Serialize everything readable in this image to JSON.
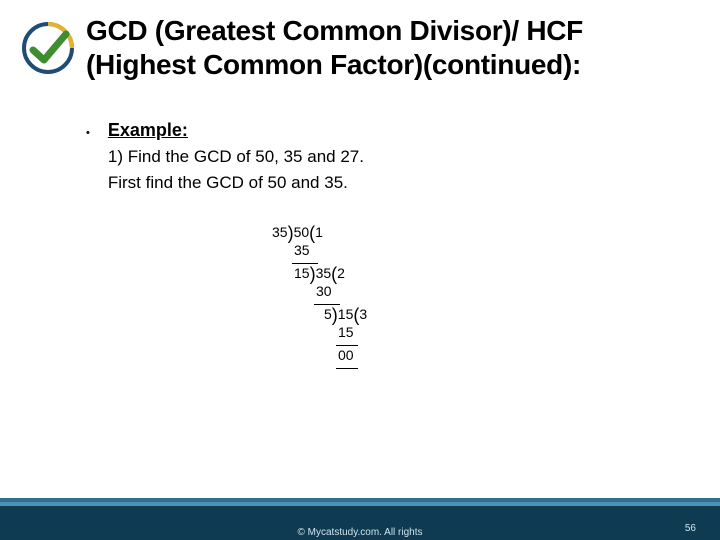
{
  "title": "GCD (Greatest Common Divisor)/ HCF (Highest Common Factor)(continued):",
  "bullet": {
    "example_label": "Example:",
    "line1": "1) Find the GCD of 50, 35 and 27.",
    "line2": "First find the GCD of 50 and 35."
  },
  "calculation": {
    "steps": [
      {
        "divisor": "35",
        "dividend": "50",
        "quotient": "1",
        "product": "35",
        "remainder": "15"
      },
      {
        "divisor": "15",
        "dividend": "35",
        "quotient": "2",
        "product": "30",
        "remainder": "5"
      },
      {
        "divisor": "5",
        "dividend": "15",
        "quotient": "3",
        "product": "15",
        "remainder": "00"
      }
    ]
  },
  "footer": {
    "copyright": "© Mycatstudy.com. All rights",
    "page_number": "56"
  },
  "colors": {
    "stripe1": "#2f6f8f",
    "stripe2": "#4a93b6",
    "footer_main": "#0f3b52",
    "footer_text": "#cfe3ee",
    "logo_blue": "#1f4c73",
    "logo_green": "#3f8d2f",
    "logo_yellow": "#e6b12e"
  }
}
